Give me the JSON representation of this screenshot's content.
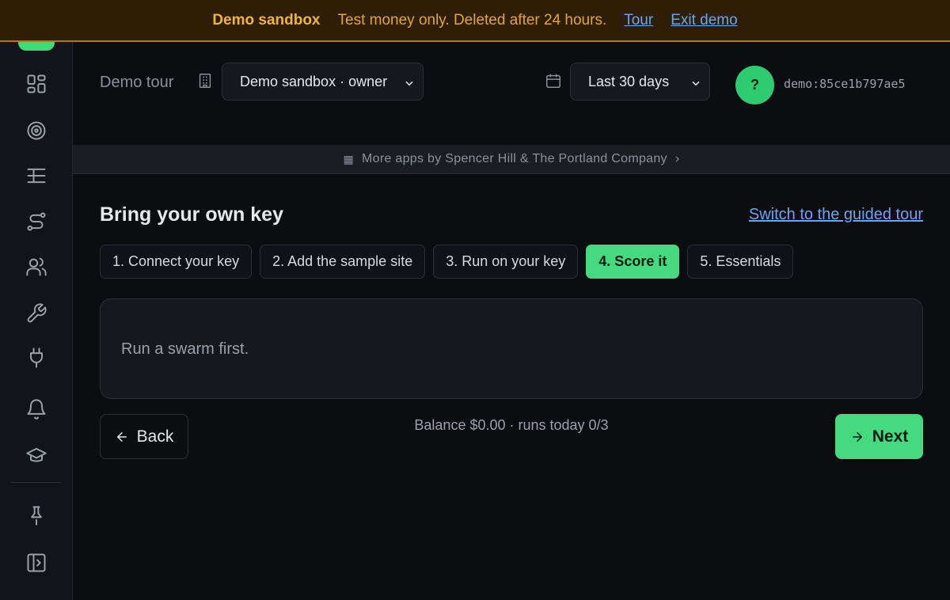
{
  "banner": {
    "title": "Demo sandbox",
    "message": "Test money only. Deleted after 24 hours.",
    "tour_link": "Tour",
    "exit_link": "Exit demo"
  },
  "sidebar": {
    "items": [
      {
        "icon": "dashboard-icon"
      },
      {
        "icon": "target-icon"
      },
      {
        "icon": "list-tree-icon"
      },
      {
        "icon": "route-icon"
      },
      {
        "icon": "users-icon"
      },
      {
        "icon": "wrench-icon"
      },
      {
        "icon": "plug-icon"
      },
      {
        "icon": "bell-icon"
      },
      {
        "icon": "graduation-cap-icon"
      },
      {
        "icon": "pin-icon"
      },
      {
        "icon": "panel-collapse-icon"
      }
    ]
  },
  "header": {
    "demo_tour_label": "Demo tour",
    "org_select": "Demo sandbox · owner",
    "range_select": "Last 30 days",
    "avatar_initial": "?",
    "user_id": "demo:85ce1b797ae5"
  },
  "apps_strip": {
    "text": "More apps by Spencer Hill & The Portland Company",
    "caret": "›"
  },
  "page": {
    "title": "Bring your own key",
    "switch_link": "Switch to the guided tour",
    "steps": [
      {
        "label": "1. Connect your key",
        "active": false
      },
      {
        "label": "2. Add the sample site",
        "active": false
      },
      {
        "label": "3. Run on your key",
        "active": false
      },
      {
        "label": "4. Score it",
        "active": true
      },
      {
        "label": "5. Essentials",
        "active": false
      }
    ],
    "panel_message": "Run a swarm first.",
    "back_label": "Back",
    "balance_text": "Balance $0.00 · runs today 0/3",
    "next_label": "Next"
  },
  "colors": {
    "accent": "#45d980",
    "banner_bg": "#2e1e06",
    "banner_text": "#e3a82b",
    "link": "#6aa6f0"
  }
}
